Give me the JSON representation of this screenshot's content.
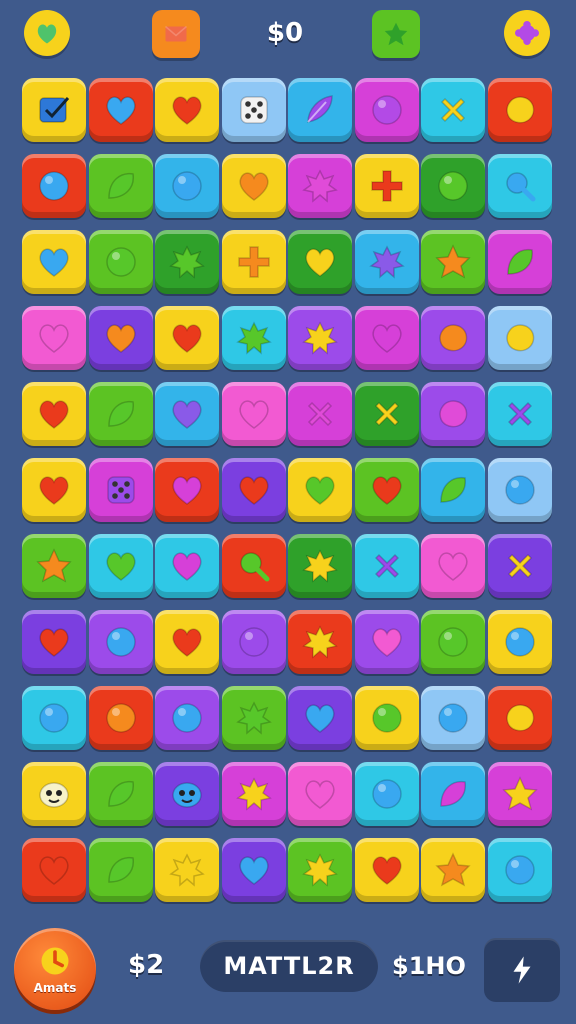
{
  "header": {
    "score": "$0",
    "left_icon": "shield-gem-icon",
    "envelope_icon": "envelope-icon",
    "star_icon": "star-icon",
    "right_icon": "flower-gem-icon"
  },
  "colors": {
    "background": "#3f5a8c",
    "yellow": "#f7d21c",
    "red": "#ea3a1c",
    "orange": "#f58a1e",
    "blue": "#33b4ea",
    "purple": "#7b3fe0",
    "magenta": "#d640d8",
    "green": "#5cc323",
    "darkgreen": "#2fa12a",
    "cyan": "#2fc8e6",
    "pink": "#f25ad2",
    "violet": "#9c4bea",
    "lightblue": "#8fc7f5"
  },
  "board": {
    "rows": [
      [
        {
          "bg": "yellow",
          "icon": "check-box",
          "c": "#2d78d8"
        },
        {
          "bg": "red",
          "icon": "heart",
          "c": "#39a8f0"
        },
        {
          "bg": "yellow",
          "icon": "heart",
          "c": "#ea3a1c"
        },
        {
          "bg": "lightblue",
          "icon": "dice",
          "c": "#f2f2f2"
        },
        {
          "bg": "blue",
          "icon": "feather",
          "c": "#9c4bea"
        },
        {
          "bg": "magenta",
          "icon": "circle",
          "c": "#b34ae6"
        },
        {
          "bg": "cyan",
          "icon": "cross",
          "c": "#f7d21c"
        },
        {
          "bg": "red",
          "icon": "blob",
          "c": "#f7d21c"
        }
      ],
      [
        {
          "bg": "red",
          "icon": "circle",
          "c": "#39a8f0"
        },
        {
          "bg": "green",
          "icon": "leaf",
          "c": "#57c72a"
        },
        {
          "bg": "blue",
          "icon": "circle",
          "c": "#39a8f0"
        },
        {
          "bg": "yellow",
          "icon": "heart",
          "c": "#f58a1e"
        },
        {
          "bg": "magenta",
          "icon": "splat",
          "c": "#e04bd8"
        },
        {
          "bg": "yellow",
          "icon": "cross4",
          "c": "#ea3a1c"
        },
        {
          "bg": "darkgreen",
          "icon": "circle",
          "c": "#57c72a"
        },
        {
          "bg": "cyan",
          "icon": "lens",
          "c": "#39a8f0"
        }
      ],
      [
        {
          "bg": "yellow",
          "icon": "heart",
          "c": "#39a8f0"
        },
        {
          "bg": "green",
          "icon": "circle",
          "c": "#57c72a"
        },
        {
          "bg": "darkgreen",
          "icon": "splat",
          "c": "#57c72a"
        },
        {
          "bg": "yellow",
          "icon": "cross4",
          "c": "#f58a1e"
        },
        {
          "bg": "darkgreen",
          "icon": "heart",
          "c": "#f7d21c"
        },
        {
          "bg": "blue",
          "icon": "splat",
          "c": "#8a5ae8"
        },
        {
          "bg": "green",
          "icon": "star",
          "c": "#f58a1e"
        },
        {
          "bg": "magenta",
          "icon": "leaf",
          "c": "#57c72a"
        }
      ],
      [
        {
          "bg": "pink",
          "icon": "heart",
          "c": "#f25ad2"
        },
        {
          "bg": "purple",
          "icon": "heart",
          "c": "#f58a1e"
        },
        {
          "bg": "yellow",
          "icon": "heart",
          "c": "#ea3a1c"
        },
        {
          "bg": "cyan",
          "icon": "splat",
          "c": "#57c72a"
        },
        {
          "bg": "violet",
          "icon": "splat",
          "c": "#f7d21c"
        },
        {
          "bg": "magenta",
          "icon": "heart",
          "c": "#d640d8"
        },
        {
          "bg": "violet",
          "icon": "blob",
          "c": "#f58a1e"
        },
        {
          "bg": "lightblue",
          "icon": "blob",
          "c": "#f7d21c"
        }
      ],
      [
        {
          "bg": "yellow",
          "icon": "heart",
          "c": "#ea3a1c"
        },
        {
          "bg": "green",
          "icon": "leaf",
          "c": "#57c72a"
        },
        {
          "bg": "blue",
          "icon": "heart",
          "c": "#8a5ae8"
        },
        {
          "bg": "pink",
          "icon": "heart",
          "c": "#f25ad2"
        },
        {
          "bg": "magenta",
          "icon": "cross",
          "c": "#e04bd8"
        },
        {
          "bg": "darkgreen",
          "icon": "cross",
          "c": "#f7d21c"
        },
        {
          "bg": "violet",
          "icon": "blob",
          "c": "#e04bd8"
        },
        {
          "bg": "cyan",
          "icon": "cross",
          "c": "#9c4bea"
        }
      ],
      [
        {
          "bg": "yellow",
          "icon": "heart",
          "c": "#ea3a1c"
        },
        {
          "bg": "magenta",
          "icon": "dice",
          "c": "#9c4bea"
        },
        {
          "bg": "red",
          "icon": "heart",
          "c": "#d640d8"
        },
        {
          "bg": "purple",
          "icon": "heart",
          "c": "#ea3a1c"
        },
        {
          "bg": "yellow",
          "icon": "heart",
          "c": "#57c72a"
        },
        {
          "bg": "green",
          "icon": "heart",
          "c": "#ea3a1c"
        },
        {
          "bg": "blue",
          "icon": "leaf",
          "c": "#57c72a"
        },
        {
          "bg": "lightblue",
          "icon": "circle",
          "c": "#39a8f0"
        }
      ],
      [
        {
          "bg": "green",
          "icon": "star",
          "c": "#f58a1e"
        },
        {
          "bg": "cyan",
          "icon": "heart",
          "c": "#57c72a"
        },
        {
          "bg": "cyan",
          "icon": "heart",
          "c": "#d640d8"
        },
        {
          "bg": "red",
          "icon": "lens",
          "c": "#57c72a"
        },
        {
          "bg": "darkgreen",
          "icon": "splat",
          "c": "#f7d21c"
        },
        {
          "bg": "cyan",
          "icon": "cross",
          "c": "#9c4bea"
        },
        {
          "bg": "pink",
          "icon": "heart",
          "c": "#f25ad2"
        },
        {
          "bg": "purple",
          "icon": "cross",
          "c": "#f7d21c"
        }
      ],
      [
        {
          "bg": "purple",
          "icon": "heart",
          "c": "#ea3a1c"
        },
        {
          "bg": "violet",
          "icon": "circle",
          "c": "#39a8f0"
        },
        {
          "bg": "yellow",
          "icon": "heart",
          "c": "#ea3a1c"
        },
        {
          "bg": "violet",
          "icon": "circle",
          "c": "#9c4bea"
        },
        {
          "bg": "red",
          "icon": "splat",
          "c": "#f7d21c"
        },
        {
          "bg": "violet",
          "icon": "heart",
          "c": "#f25ad2"
        },
        {
          "bg": "green",
          "icon": "circle",
          "c": "#57c72a"
        },
        {
          "bg": "yellow",
          "icon": "circle",
          "c": "#39a8f0"
        }
      ],
      [
        {
          "bg": "cyan",
          "icon": "circle",
          "c": "#39a8f0"
        },
        {
          "bg": "red",
          "icon": "circle",
          "c": "#f58a1e"
        },
        {
          "bg": "violet",
          "icon": "circle",
          "c": "#39a8f0"
        },
        {
          "bg": "green",
          "icon": "splat",
          "c": "#57c72a"
        },
        {
          "bg": "purple",
          "icon": "heart",
          "c": "#39a8f0"
        },
        {
          "bg": "yellow",
          "icon": "circle",
          "c": "#57c72a"
        },
        {
          "bg": "lightblue",
          "icon": "circle",
          "c": "#39a8f0"
        },
        {
          "bg": "red",
          "icon": "blob",
          "c": "#f7d21c"
        }
      ],
      [
        {
          "bg": "yellow",
          "icon": "face",
          "c": "#f7f2c8"
        },
        {
          "bg": "green",
          "icon": "leaf",
          "c": "#57c72a"
        },
        {
          "bg": "purple",
          "icon": "face",
          "c": "#39a8f0"
        },
        {
          "bg": "magenta",
          "icon": "splat",
          "c": "#f7d21c"
        },
        {
          "bg": "pink",
          "icon": "heart",
          "c": "#f25ad2"
        },
        {
          "bg": "cyan",
          "icon": "circle",
          "c": "#39a8f0"
        },
        {
          "bg": "blue",
          "icon": "leaf",
          "c": "#d640d8"
        },
        {
          "bg": "magenta",
          "icon": "star",
          "c": "#f7d21c"
        }
      ],
      [
        {
          "bg": "red",
          "icon": "heart",
          "c": "#ea3a1c"
        },
        {
          "bg": "green",
          "icon": "leaf",
          "c": "#57c72a"
        },
        {
          "bg": "yellow",
          "icon": "splat",
          "c": "#f7d21c"
        },
        {
          "bg": "purple",
          "icon": "heart",
          "c": "#39a8f0"
        },
        {
          "bg": "green",
          "icon": "splat",
          "c": "#f7d21c"
        },
        {
          "bg": "yellow",
          "icon": "heart",
          "c": "#ea3a1c"
        },
        {
          "bg": "yellow",
          "icon": "star",
          "c": "#f58a1e"
        },
        {
          "bg": "cyan",
          "icon": "circle",
          "c": "#39a8f0"
        }
      ]
    ]
  },
  "footer": {
    "action_label": "Amats",
    "left_stat": "$2",
    "name": "MATTL2R",
    "right_stat": "$1HO",
    "menu_icon": "bolt-icon"
  }
}
